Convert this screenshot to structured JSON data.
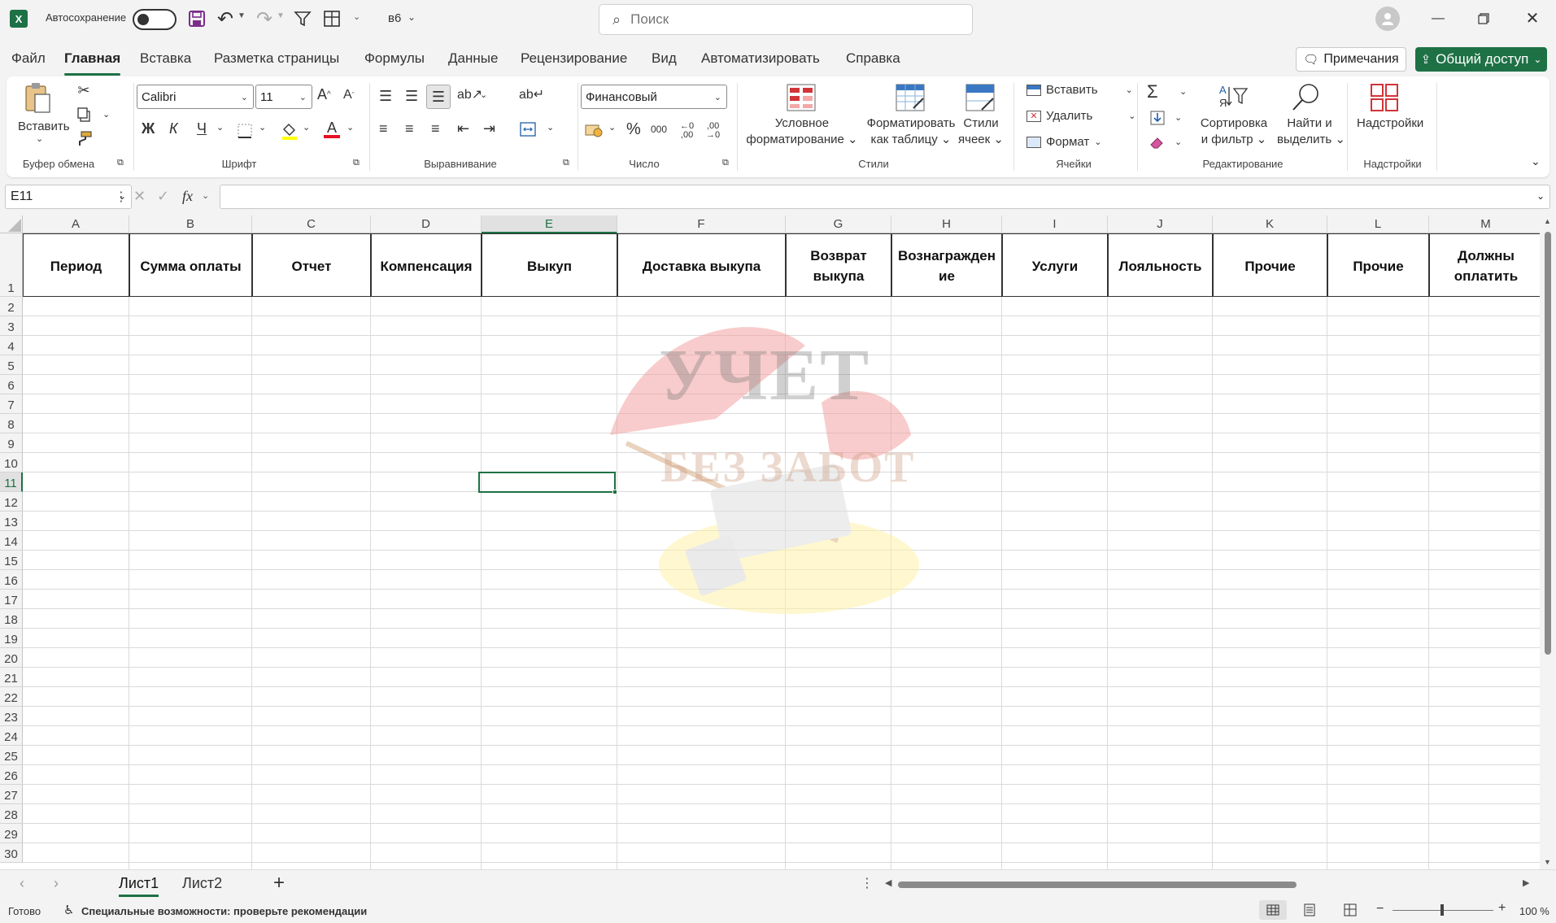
{
  "titlebar": {
    "autosave_label": "Автосохранение",
    "file_name": "в6",
    "search_placeholder": "Поиск"
  },
  "menu": {
    "tabs": [
      "Файл",
      "Главная",
      "Вставка",
      "Разметка страницы",
      "Формулы",
      "Данные",
      "Рецензирование",
      "Вид",
      "Автоматизировать",
      "Справка"
    ],
    "notes_label": "Примечания",
    "share_label": "Общий доступ"
  },
  "ribbon": {
    "clipboard": {
      "paste_label": "Вставить",
      "group_label": "Буфер обмена"
    },
    "font": {
      "family": "Calibri",
      "size": "11",
      "bold": "Ж",
      "italic": "К",
      "underline": "Ч",
      "group_label": "Шрифт"
    },
    "alignment": {
      "group_label": "Выравнивание"
    },
    "number": {
      "format": "Финансовый",
      "group_label": "Число"
    },
    "styles": {
      "conditional_line1": "Условное",
      "conditional_line2": "форматирование",
      "as_table_line1": "Форматировать",
      "as_table_line2": "как таблицу",
      "cell_styles_line1": "Стили",
      "cell_styles_line2": "ячеек",
      "group_label": "Стили"
    },
    "cells": {
      "insert": "Вставить",
      "delete": "Удалить",
      "format": "Формат",
      "group_label": "Ячейки"
    },
    "editing": {
      "sort_line1": "Сортировка",
      "sort_line2": "и фильтр",
      "find_line1": "Найти и",
      "find_line2": "выделить",
      "group_label": "Редактирование"
    },
    "addins": {
      "label": "Надстройки",
      "group_label": "Надстройки"
    }
  },
  "formula_bar": {
    "name_box": "E11",
    "fx": "fx",
    "value": ""
  },
  "sheet": {
    "columns": [
      "A",
      "B",
      "C",
      "D",
      "E",
      "F",
      "G",
      "H",
      "I",
      "J",
      "K",
      "L",
      "M"
    ],
    "rows": [
      "1",
      "2",
      "3",
      "4",
      "5",
      "6",
      "7",
      "8",
      "9",
      "10",
      "11",
      "12",
      "13",
      "14",
      "15",
      "16",
      "17",
      "18",
      "19",
      "20",
      "21",
      "22",
      "23",
      "24",
      "25",
      "26",
      "27",
      "28",
      "29",
      "30"
    ],
    "header_row": [
      [
        "Период"
      ],
      [
        "Сумма оплаты"
      ],
      [
        "Отчет"
      ],
      [
        "Компенсация"
      ],
      [
        "Выкуп"
      ],
      [
        "Доставка выкупа"
      ],
      [
        "Возврат",
        "выкупа"
      ],
      [
        "Вознагражден",
        "ие"
      ],
      [
        "Услуги"
      ],
      [
        "Лояльность"
      ],
      [
        "Прочие"
      ],
      [
        "Прочие"
      ],
      [
        "Должны",
        "оплатить"
      ]
    ],
    "selected_cell": "E11",
    "watermark_line1": "УЧЕТ",
    "watermark_line2": "БЕЗ ЗАБОТ"
  },
  "sheet_tabs": [
    "Лист1",
    "Лист2"
  ],
  "status": {
    "ready": "Готово",
    "accessibility": "Специальные возможности: проверьте рекомендации",
    "zoom": "100 %"
  },
  "colors": {
    "accent": "#1e7145",
    "share_bg": "#1e7145"
  }
}
